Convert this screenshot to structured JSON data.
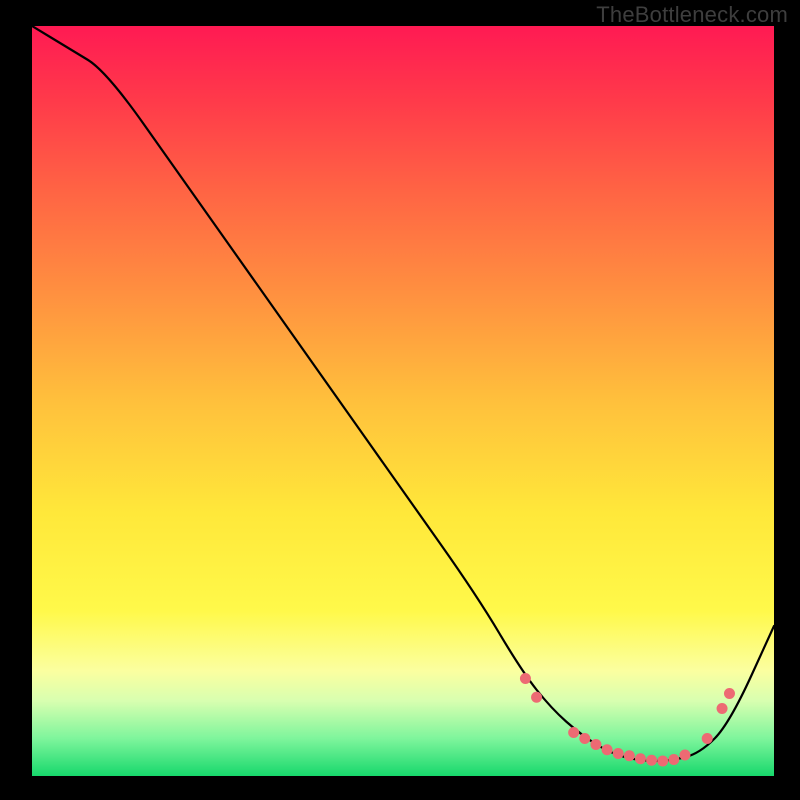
{
  "watermark": "TheBottleneck.com",
  "chart_data": {
    "type": "line",
    "title": "",
    "xlabel": "",
    "ylabel": "",
    "xlim": [
      0,
      100
    ],
    "ylim": [
      0,
      100
    ],
    "series": [
      {
        "name": "bottleneck-curve",
        "x": [
          0,
          5,
          10,
          20,
          30,
          40,
          50,
          60,
          66,
          70,
          74,
          78,
          82,
          86,
          90,
          94,
          100
        ],
        "y": [
          100,
          97,
          94,
          80,
          66,
          52,
          38,
          24,
          14,
          9,
          5.5,
          3,
          2,
          2,
          3,
          7,
          20
        ]
      }
    ],
    "markers": {
      "name": "highlighted-points",
      "color": "#ed6a73",
      "points": [
        {
          "x": 66.5,
          "y": 13
        },
        {
          "x": 68,
          "y": 10.5
        },
        {
          "x": 73,
          "y": 5.8
        },
        {
          "x": 74.5,
          "y": 5
        },
        {
          "x": 76,
          "y": 4.2
        },
        {
          "x": 77.5,
          "y": 3.5
        },
        {
          "x": 79,
          "y": 3
        },
        {
          "x": 80.5,
          "y": 2.7
        },
        {
          "x": 82,
          "y": 2.3
        },
        {
          "x": 83.5,
          "y": 2.1
        },
        {
          "x": 85,
          "y": 2
        },
        {
          "x": 86.5,
          "y": 2.2
        },
        {
          "x": 88,
          "y": 2.8
        },
        {
          "x": 91,
          "y": 5
        },
        {
          "x": 93,
          "y": 9
        },
        {
          "x": 94,
          "y": 11
        }
      ]
    },
    "gradient_stops": [
      {
        "offset": 0.0,
        "color": "#ff1a53"
      },
      {
        "offset": 0.1,
        "color": "#ff3a4a"
      },
      {
        "offset": 0.22,
        "color": "#ff6444"
      },
      {
        "offset": 0.35,
        "color": "#ff8e40"
      },
      {
        "offset": 0.5,
        "color": "#ffc03c"
      },
      {
        "offset": 0.65,
        "color": "#ffe83a"
      },
      {
        "offset": 0.78,
        "color": "#fff94a"
      },
      {
        "offset": 0.86,
        "color": "#fbffa0"
      },
      {
        "offset": 0.9,
        "color": "#d8ffb0"
      },
      {
        "offset": 0.95,
        "color": "#7ef59c"
      },
      {
        "offset": 1.0,
        "color": "#17d86c"
      }
    ]
  }
}
